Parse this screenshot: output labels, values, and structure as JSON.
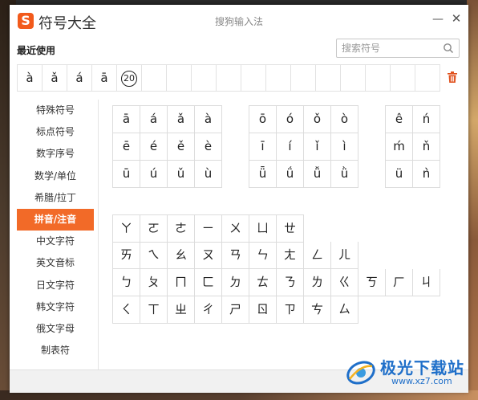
{
  "window": {
    "app_title": "符号大全",
    "caption": "搜狗输入法",
    "minimize_label": "—",
    "close_label": "✕",
    "logo_letter": "S"
  },
  "recent": {
    "label": "最近使用",
    "items": [
      "à",
      "ǎ",
      "á",
      "ā",
      "⑳",
      "",
      "",
      "",
      "",
      "",
      "",
      "",
      "",
      "",
      "",
      "",
      ""
    ]
  },
  "search": {
    "placeholder": "搜索符号"
  },
  "sidebar": {
    "items": [
      {
        "label": "特殊符号"
      },
      {
        "label": "标点符号"
      },
      {
        "label": "数字序号"
      },
      {
        "label": "数学/单位"
      },
      {
        "label": "希腊/拉丁"
      },
      {
        "label": "拼音/注音",
        "active": true
      },
      {
        "label": "中文字符"
      },
      {
        "label": "英文音标"
      },
      {
        "label": "日文字符"
      },
      {
        "label": "韩文字符"
      },
      {
        "label": "俄文字母"
      },
      {
        "label": "制表符"
      }
    ]
  },
  "pinyin": {
    "group1": [
      [
        "ā",
        "á",
        "ǎ",
        "à"
      ],
      [
        "ē",
        "é",
        "ě",
        "è"
      ],
      [
        "ū",
        "ú",
        "ǔ",
        "ù"
      ]
    ],
    "group2": [
      [
        "ō",
        "ó",
        "ǒ",
        "ò"
      ],
      [
        "ī",
        "í",
        "ǐ",
        "ì"
      ],
      [
        "ǖ",
        "ǘ",
        "ǚ",
        "ǜ"
      ]
    ],
    "group3": [
      [
        "ê",
        "ń"
      ],
      [
        "ḿ",
        "ň"
      ],
      [
        "ü",
        "ǹ"
      ]
    ]
  },
  "zhuyin": {
    "row1": [
      "ㄚ",
      "ㄛ",
      "ㄜ",
      "ㄧ",
      "ㄨ",
      "ㄩ",
      "ㄝ"
    ],
    "row2": [
      "ㄞ",
      "ㄟ",
      "ㄠ",
      "ㄡ",
      "ㄢ",
      "ㄣ",
      "ㄤ",
      "ㄥ",
      "ㄦ"
    ],
    "row3": [
      "ㄅ",
      "ㄆ",
      "ㄇ",
      "ㄈ",
      "ㄉ",
      "ㄊ",
      "ㄋ",
      "ㄌ",
      "ㄍ",
      "ㄎ",
      "ㄏ",
      "ㄐ"
    ],
    "row4": [
      "ㄑ",
      "ㄒ",
      "ㄓ",
      "ㄔ",
      "ㄕ",
      "ㄖ",
      "ㄗ",
      "ㄘ",
      "ㄙ"
    ]
  },
  "watermark": {
    "text": "极光下载站",
    "url": "www.xz7.com"
  },
  "colors": {
    "accent": "#f26a28",
    "logo": "#f25a1b",
    "trash": "#e0521f",
    "watermark": "#1f6fc9"
  }
}
